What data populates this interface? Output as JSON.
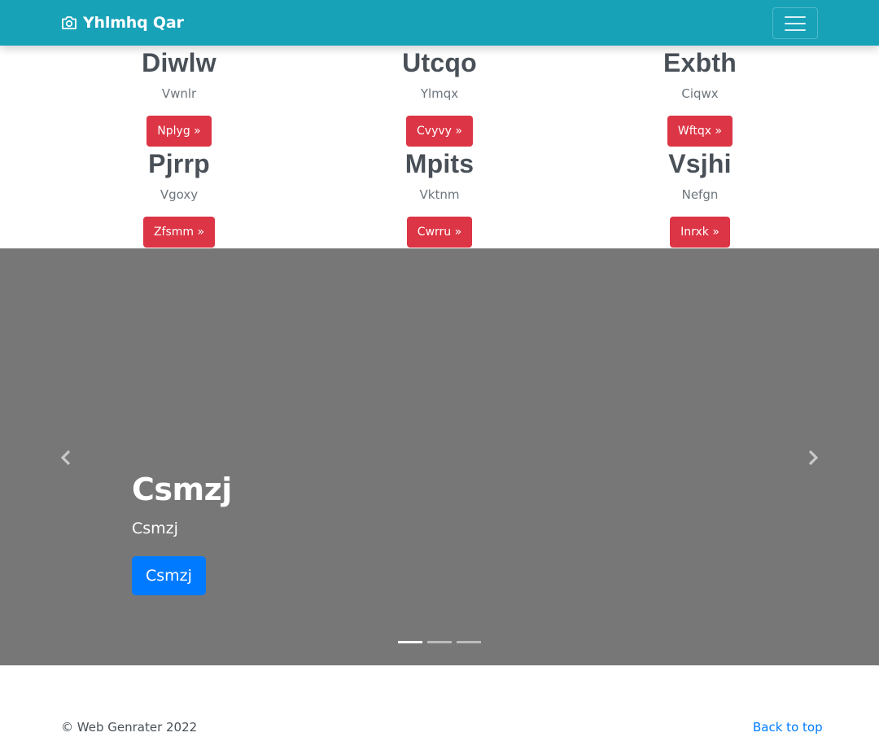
{
  "navbar": {
    "brand": "Yhlmhq Qar",
    "brand_icon": "camera-icon",
    "toggler_icon": "hamburger-icon",
    "background": "#17a2b8"
  },
  "features": [
    {
      "title": "Diwlw",
      "text": "Vwnlr",
      "button": "Nplyg »"
    },
    {
      "title": "Utcqo",
      "text": "Ylmqx",
      "button": "Cvyvy »"
    },
    {
      "title": "Exbth",
      "text": "Ciqwx",
      "button": "Wftqx »"
    },
    {
      "title": "Pjrrp",
      "text": "Vgoxy",
      "button": "Zfsmm »"
    },
    {
      "title": "Mpits",
      "text": "Vktnm",
      "button": "Cwrru »"
    },
    {
      "title": "Vsjhi",
      "text": "Nefgn",
      "button": "Inrxk »"
    }
  ],
  "carousel": {
    "heading": "Csmzj",
    "text": "Csmzj",
    "button": "Csmzj",
    "prev_icon": "chevron-left-icon",
    "next_icon": "chevron-right-icon",
    "slide_count": 3,
    "active_slide": 1,
    "background": "#777777"
  },
  "footer": {
    "copyright": "© Web Genrater 2022",
    "back_to_top": "Back to top"
  },
  "colors": {
    "danger": "#dc3545",
    "primary": "#007bff",
    "heading_gray": "#495057",
    "muted": "#6c757d"
  }
}
